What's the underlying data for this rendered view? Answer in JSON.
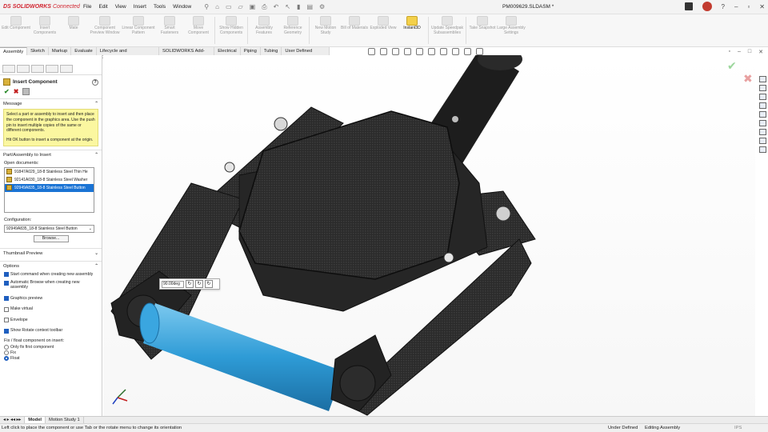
{
  "app": {
    "ds_mark": "DS",
    "brand": "SOLIDWORKS",
    "brand_suffix": "Connected",
    "doc_title": "PM009629.SLDASM *"
  },
  "menu": [
    "File",
    "Edit",
    "View",
    "Insert",
    "Tools",
    "Window"
  ],
  "ribbon": [
    {
      "label": "Edit Component",
      "active": false
    },
    {
      "label": "Insert Components",
      "active": false
    },
    {
      "label": "Mate",
      "active": false
    },
    {
      "label": "Component Preview Window",
      "active": false
    },
    {
      "label": "Linear Component Pattern",
      "active": false
    },
    {
      "label": "Smart Fasteners",
      "active": false
    },
    {
      "label": "Move Component",
      "active": false
    },
    {
      "label": "Show Hidden Components",
      "active": false
    },
    {
      "label": "Assembly Features",
      "active": false
    },
    {
      "label": "Reference Geometry",
      "active": false
    },
    {
      "label": "New Motion Study",
      "active": false
    },
    {
      "label": "Bill of Materials",
      "active": false
    },
    {
      "label": "Exploded View",
      "active": false
    },
    {
      "label": "Instant3D",
      "active": true
    },
    {
      "label": "Update Speedpak Subassemblies",
      "active": false
    },
    {
      "label": "Take Snapshot",
      "active": false
    },
    {
      "label": "Large Assembly Settings",
      "active": false
    }
  ],
  "tabs": [
    "Assembly",
    "Sketch",
    "Markup",
    "Evaluate",
    "Lifecycle and Collaboration",
    "SOLIDWORKS Add-Ins",
    "Electrical",
    "Piping",
    "Tubing",
    "User Defined Route"
  ],
  "property_manager": {
    "title": "Insert Component",
    "message_header": "Message",
    "message_1": "Select a part or assembly to insert and then place the component in the graphics area. Use the push pin to insert multiple copies of the same or different components.",
    "message_2": "Hit OK button to insert a component at the origin.",
    "part_header": "Part/Assembly to Insert",
    "open_docs_label": "Open documents:",
    "documents": [
      {
        "name": "91847A029_18-8 Stainless Steel Thin He",
        "selected": false
      },
      {
        "name": "92141A030_18-8 Stainless Steel Washer",
        "selected": false
      },
      {
        "name": "92949A835_18-8 Stainless Steel Button",
        "selected": true
      }
    ],
    "config_label": "Configuration:",
    "config_value": "92949A835_18-8 Stainless Steel Button",
    "browse_label": "Browse...",
    "thumb_header": "Thumbnail Preview",
    "options_header": "Options",
    "options": [
      {
        "label": "Start command when creating new assembly",
        "checked": true
      },
      {
        "label": "Automatic Browse when creating new assembly",
        "checked": true
      },
      {
        "label": "Graphics preview",
        "checked": true
      },
      {
        "label": "Make virtual",
        "checked": false
      },
      {
        "label": "Envelope",
        "checked": false
      },
      {
        "label": "Show Rotate context toolbar",
        "checked": true
      }
    ],
    "fix_label": "Fix / float component on insert:",
    "fix_options": [
      {
        "label": "Only fix first component",
        "selected": false
      },
      {
        "label": "Fix",
        "selected": false
      },
      {
        "label": "Float",
        "selected": true
      }
    ]
  },
  "rotate_toolbar": {
    "value": "90.00deg"
  },
  "bottom_tabs": [
    "Model",
    "Motion Study 1"
  ],
  "status": {
    "hint": "Left click to place the component or use Tab or the rotate menu to change its orientation",
    "state": "Under Defined",
    "mode": "Editing Assembly",
    "units": "IPS"
  },
  "colors": {
    "accent": "#1a73d4",
    "brand": "#d1242f",
    "cylinder": "#2e9bd6",
    "message_bg": "#fbf7a0"
  }
}
